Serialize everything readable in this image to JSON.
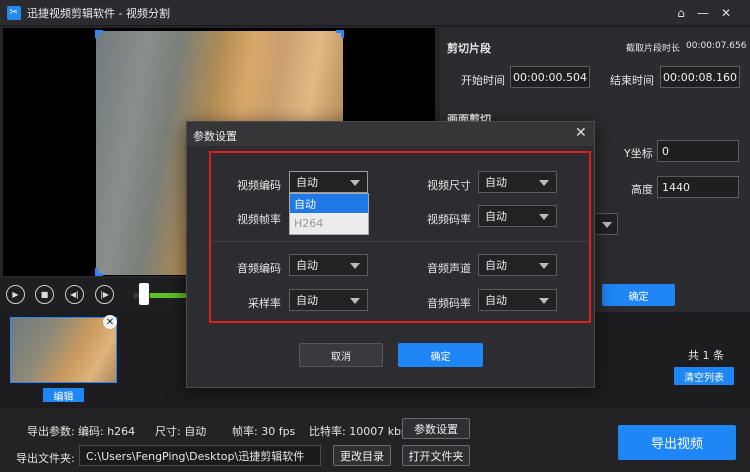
{
  "titlebar": {
    "app_name": "迅捷视频剪辑软件",
    "separator": "-",
    "section": "视频分割",
    "icons": [
      "home-icon",
      "minimize-icon",
      "close-icon"
    ]
  },
  "clip_segment": {
    "heading": "剪切片段",
    "duration_label": "截取片段时长",
    "duration_value": "00:00:07.656",
    "start_label": "开始时间",
    "start_value": "00:00:00.504",
    "end_label": "结束时间",
    "end_value": "00:00:08.160",
    "crop_heading": "画面剪切",
    "y_label": "Y坐标",
    "y_value": "0",
    "height_label": "高度",
    "height_value": "1440",
    "confirm_label": "确定"
  },
  "player": {
    "controls": [
      "play-icon",
      "stop-icon",
      "prev-frame-icon",
      "next-frame-icon"
    ],
    "progress_fraction": 0.08
  },
  "clip_list": {
    "edit_label": "编辑",
    "total_label": "共 1 条",
    "clear_label": "清空列表"
  },
  "export": {
    "params_label": "导出参数:",
    "codec": "编码: h264",
    "size": "尺寸: 自动",
    "fps": "帧率: 30 fps",
    "bitrate": "比特率: 10007 kbs",
    "params_button": "参数设置",
    "folder_label": "导出文件夹:",
    "folder_path": "C:\\Users\\FengPing\\Desktop\\迅捷剪辑软件",
    "change_dir": "更改目录",
    "open_folder": "打开文件夹",
    "export_button": "导出视频"
  },
  "dialog": {
    "title": "参数设置",
    "video_codec_label": "视频编码",
    "video_codec_value": "自动",
    "video_codec_options": [
      "自动",
      "H264"
    ],
    "video_size_label": "视频尺寸",
    "video_size_value": "自动",
    "video_fps_label": "视频帧率",
    "video_bitrate_label": "视频码率",
    "video_bitrate_value": "自动",
    "audio_codec_label": "音频编码",
    "audio_codec_value": "自动",
    "audio_channel_label": "音频声道",
    "audio_channel_value": "自动",
    "sample_rate_label": "采样率",
    "sample_rate_value": "自动",
    "audio_bitrate_label": "音频码率",
    "audio_bitrate_value": "自动",
    "cancel_label": "取消",
    "ok_label": "确定"
  },
  "colors": {
    "accent": "#1e86f5",
    "highlight_border": "#e02020",
    "progress": "#5fbf2a"
  }
}
